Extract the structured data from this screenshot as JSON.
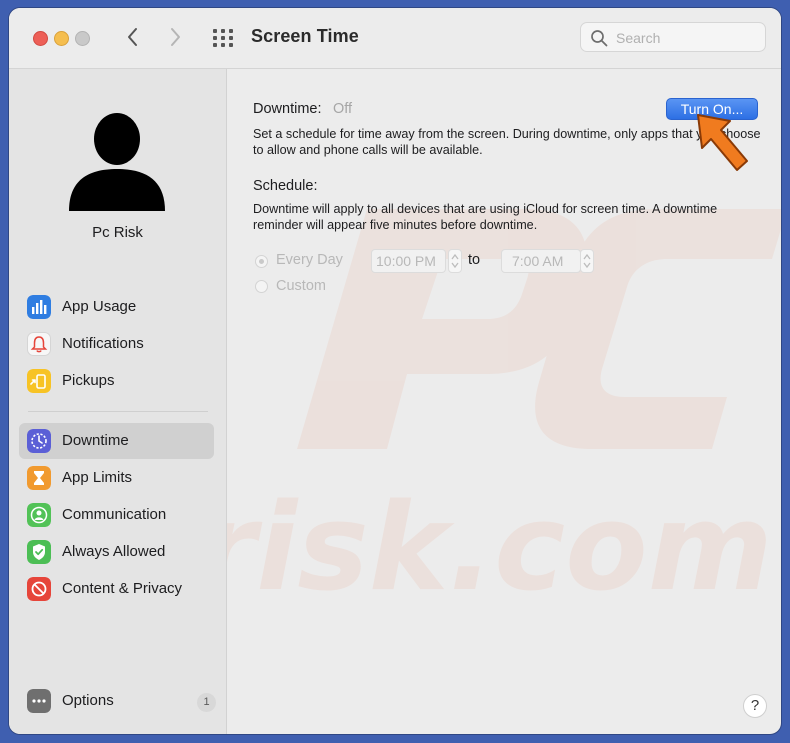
{
  "window": {
    "title": "Screen Time",
    "search_placeholder": "Search"
  },
  "account": {
    "name": "Pc Risk"
  },
  "sidebar": {
    "items": [
      {
        "label": "App Usage",
        "icon": "bar-chart-icon",
        "color": "#2f7de1"
      },
      {
        "label": "Notifications",
        "icon": "bell-icon",
        "color": "#f2f2f2"
      },
      {
        "label": "Pickups",
        "icon": "pickup-icon",
        "color": "#f7c325"
      },
      {
        "label": "Downtime",
        "icon": "downtime-icon",
        "color": "#5b5fd6",
        "selected": true
      },
      {
        "label": "App Limits",
        "icon": "hourglass-icon",
        "color": "#f19a2f"
      },
      {
        "label": "Communication",
        "icon": "person-icon",
        "color": "#52c257"
      },
      {
        "label": "Always Allowed",
        "icon": "checkmark-icon",
        "color": "#4cbe55"
      },
      {
        "label": "Content & Privacy",
        "icon": "no-entry-icon",
        "color": "#e6453a"
      }
    ],
    "options": {
      "label": "Options",
      "badge": "1",
      "icon": "ellipsis-icon"
    }
  },
  "downtime": {
    "label": "Downtime:",
    "status": "Off",
    "button": "Turn On...",
    "description": "Set a schedule for time away from the screen. During downtime, only apps that you choose to allow and phone calls will be available."
  },
  "schedule": {
    "label": "Schedule:",
    "description": "Downtime will apply to all devices that are using iCloud for screen time. A downtime reminder will appear five minutes before downtime.",
    "options": [
      {
        "label": "Every Day",
        "selected": true
      },
      {
        "label": "Custom",
        "selected": false
      }
    ],
    "from_time": "10:00 PM",
    "to_label": "to",
    "to_time": "7:00 AM"
  },
  "help_label": "?",
  "colors": {
    "accent": "#2d6fe4",
    "desktop": "#3f5fb0",
    "watermark": "#e8a88f",
    "arrow": "#f07b1f"
  }
}
